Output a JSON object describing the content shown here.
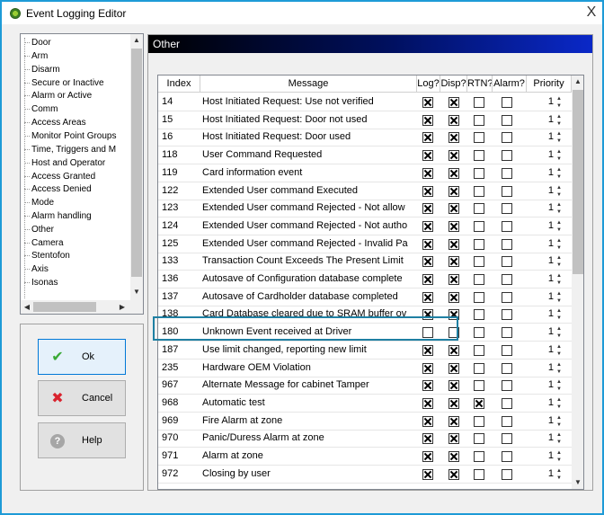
{
  "window": {
    "title": "Event Logging Editor",
    "close_glyph": "X"
  },
  "tree": {
    "items": [
      "Door",
      "Arm",
      "Disarm",
      "Secure or Inactive",
      "Alarm or Active",
      "Comm",
      "Access Areas",
      "Monitor Point Groups",
      "Time, Triggers and M",
      "Host and Operator",
      "Access Granted",
      "Access Denied",
      "Mode",
      "Alarm handling",
      "Other",
      "Camera",
      "Stentofon",
      "Axis",
      "Isonas"
    ],
    "selected": "Other"
  },
  "buttons": {
    "ok": "Ok",
    "cancel": "Cancel",
    "help": "Help"
  },
  "panel": {
    "header": "Other"
  },
  "grid": {
    "columns": [
      "Index",
      "Message",
      "Log?",
      "Disp?",
      "RTN?",
      "Alarm?",
      "Priority"
    ],
    "rows": [
      {
        "index": "14",
        "message": "Host Initiated Request: Use not verified",
        "log": true,
        "disp": true,
        "rtn": false,
        "alarm": false,
        "priority": "1"
      },
      {
        "index": "15",
        "message": "Host Initiated Request: Door not used",
        "log": true,
        "disp": true,
        "rtn": false,
        "alarm": false,
        "priority": "1"
      },
      {
        "index": "16",
        "message": "Host Initiated Request: Door used",
        "log": true,
        "disp": true,
        "rtn": false,
        "alarm": false,
        "priority": "1"
      },
      {
        "index": "118",
        "message": "User Command Requested",
        "log": true,
        "disp": true,
        "rtn": false,
        "alarm": false,
        "priority": "1"
      },
      {
        "index": "119",
        "message": "Card information event",
        "log": true,
        "disp": true,
        "rtn": false,
        "alarm": false,
        "priority": "1"
      },
      {
        "index": "122",
        "message": "Extended User command Executed",
        "log": true,
        "disp": true,
        "rtn": false,
        "alarm": false,
        "priority": "1"
      },
      {
        "index": "123",
        "message": "Extended User command Rejected - Not allow",
        "log": true,
        "disp": true,
        "rtn": false,
        "alarm": false,
        "priority": "1"
      },
      {
        "index": "124",
        "message": "Extended User command Rejected - Not autho",
        "log": true,
        "disp": true,
        "rtn": false,
        "alarm": false,
        "priority": "1"
      },
      {
        "index": "125",
        "message": "Extended User command Rejected - Invalid Pa",
        "log": true,
        "disp": true,
        "rtn": false,
        "alarm": false,
        "priority": "1"
      },
      {
        "index": "133",
        "message": "Transaction Count Exceeds The Present Limit",
        "log": true,
        "disp": true,
        "rtn": false,
        "alarm": false,
        "priority": "1"
      },
      {
        "index": "136",
        "message": "Autosave of Configuration database complete",
        "log": true,
        "disp": true,
        "rtn": false,
        "alarm": false,
        "priority": "1"
      },
      {
        "index": "137",
        "message": "Autosave of Cardholder database completed",
        "log": true,
        "disp": true,
        "rtn": false,
        "alarm": false,
        "priority": "1"
      },
      {
        "index": "138",
        "message": "Card Database cleared due to SRAM buffer ov",
        "log": true,
        "disp": true,
        "rtn": false,
        "alarm": false,
        "priority": "1"
      },
      {
        "index": "180",
        "message": "Unknown Event received at Driver",
        "log": false,
        "disp": false,
        "rtn": false,
        "alarm": false,
        "priority": "1"
      },
      {
        "index": "187",
        "message": "Use limit changed, reporting new limit",
        "log": true,
        "disp": true,
        "rtn": false,
        "alarm": false,
        "priority": "1"
      },
      {
        "index": "235",
        "message": "Hardware OEM Violation",
        "log": true,
        "disp": true,
        "rtn": false,
        "alarm": false,
        "priority": "1"
      },
      {
        "index": "967",
        "message": "Alternate Message for cabinet Tamper",
        "log": true,
        "disp": true,
        "rtn": false,
        "alarm": false,
        "priority": "1"
      },
      {
        "index": "968",
        "message": "Automatic test",
        "log": true,
        "disp": true,
        "rtn": true,
        "alarm": false,
        "priority": "1"
      },
      {
        "index": "969",
        "message": "Fire Alarm at zone",
        "log": true,
        "disp": true,
        "rtn": false,
        "alarm": false,
        "priority": "1"
      },
      {
        "index": "970",
        "message": "Panic/Duress Alarm at zone",
        "log": true,
        "disp": true,
        "rtn": false,
        "alarm": false,
        "priority": "1"
      },
      {
        "index": "971",
        "message": "Alarm at zone",
        "log": true,
        "disp": true,
        "rtn": false,
        "alarm": false,
        "priority": "1"
      },
      {
        "index": "972",
        "message": "Closing by user",
        "log": true,
        "disp": true,
        "rtn": false,
        "alarm": false,
        "priority": "1"
      }
    ]
  },
  "colors": {
    "focus_border": "#1e9bd7",
    "highlight_box": "#1f80a3",
    "header_gradient_end": "#0a28c8"
  },
  "icons": {
    "app": "app-logo-icon",
    "ok": "check-icon",
    "cancel": "x-icon",
    "help": "question-icon"
  }
}
